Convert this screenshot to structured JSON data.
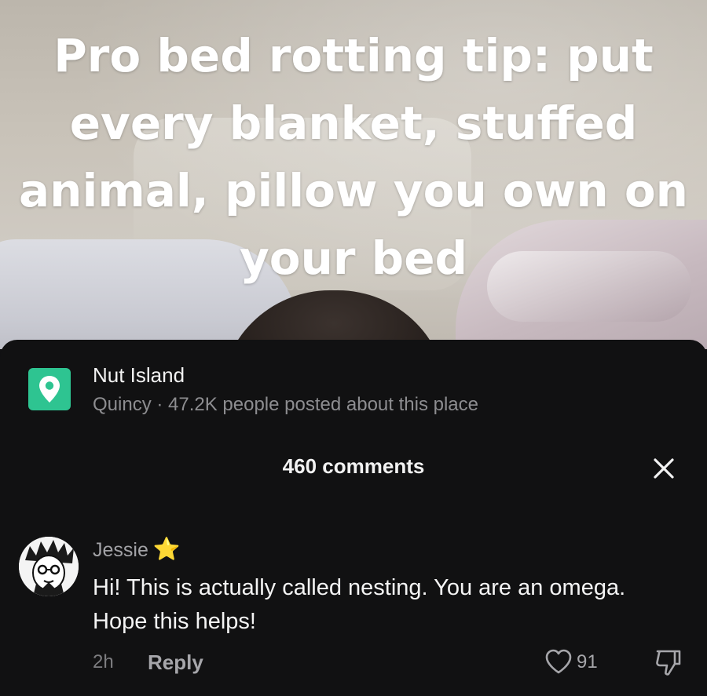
{
  "video": {
    "caption_lines": [
      "Pro bed rotting tip: put",
      "every blanket, stuffed",
      "animal, pillow you own on",
      "your bed"
    ]
  },
  "place": {
    "icon": "location-pin-icon",
    "name": "Nut Island",
    "meta": "Quincy · 47.2K people posted about this place",
    "accent": "#2ec491"
  },
  "comments_header": {
    "title": "460 comments",
    "close_icon": "close-icon"
  },
  "comment": {
    "username": "Jessie",
    "badge": "⭐",
    "text": "Hi! This is actually called nesting. You are an omega. Hope this helps!",
    "time": "2h",
    "reply_label": "Reply",
    "like_count": "91",
    "like_icon": "heart-icon",
    "dislike_icon": "thumbs-down-icon"
  }
}
